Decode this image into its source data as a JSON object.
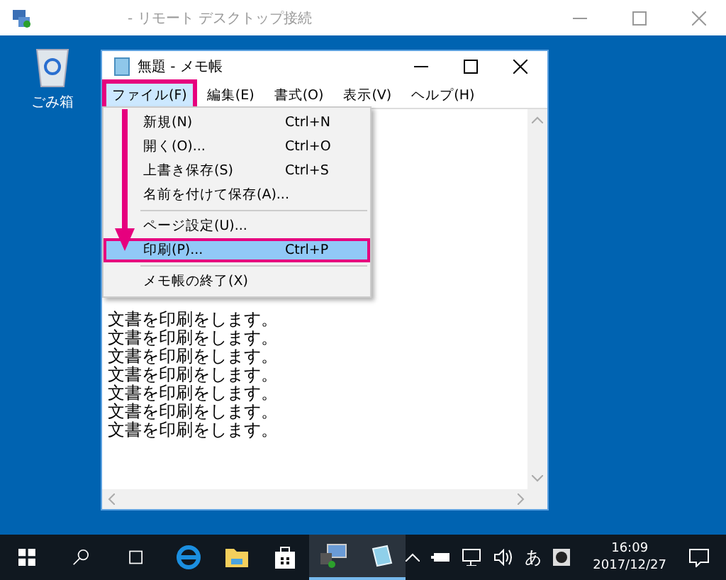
{
  "remote_window": {
    "title": "- リモート デスクトップ接続"
  },
  "desktop_icons": [
    {
      "label": "ごみ箱"
    }
  ],
  "notepad": {
    "title": "無題 - メモ帳",
    "menu_bar": [
      {
        "label": "ファイル(F)",
        "selected": true
      },
      {
        "label": "編集(E)",
        "selected": false
      },
      {
        "label": "書式(O)",
        "selected": false
      },
      {
        "label": "表示(V)",
        "selected": false
      },
      {
        "label": "ヘルプ(H)",
        "selected": false
      }
    ],
    "lines": [
      "文書を印刷をします。",
      "文書を印刷をします。",
      "文書を印刷をします。",
      "文書を印刷をします。",
      "文書を印刷をします。",
      "文書を印刷をします。",
      "文書を印刷をします。"
    ]
  },
  "file_menu": [
    {
      "kind": "item",
      "label": "新規(N)",
      "shortcut": "Ctrl+N",
      "selected": false
    },
    {
      "kind": "item",
      "label": "開く(O)...",
      "shortcut": "Ctrl+O",
      "selected": false
    },
    {
      "kind": "item",
      "label": "上書き保存(S)",
      "shortcut": "Ctrl+S",
      "selected": false
    },
    {
      "kind": "item",
      "label": "名前を付けて保存(A)...",
      "selected": false
    },
    {
      "kind": "separator"
    },
    {
      "kind": "item",
      "label": "ページ設定(U)...",
      "selected": false
    },
    {
      "kind": "item",
      "label": "印刷(P)...",
      "shortcut": "Ctrl+P",
      "selected": true
    },
    {
      "kind": "separator"
    },
    {
      "kind": "item",
      "label": "メモ帳の終了(X)",
      "selected": false
    }
  ],
  "taskbar": {
    "apps": [
      {
        "kind": "edge",
        "active": false
      },
      {
        "kind": "explorer",
        "active": false
      },
      {
        "kind": "store",
        "active": false
      },
      {
        "kind": "remote",
        "active": true
      },
      {
        "kind": "notepad",
        "active": true
      }
    ],
    "ime": "あ",
    "time": "16:09",
    "date": "2017/12/27"
  }
}
